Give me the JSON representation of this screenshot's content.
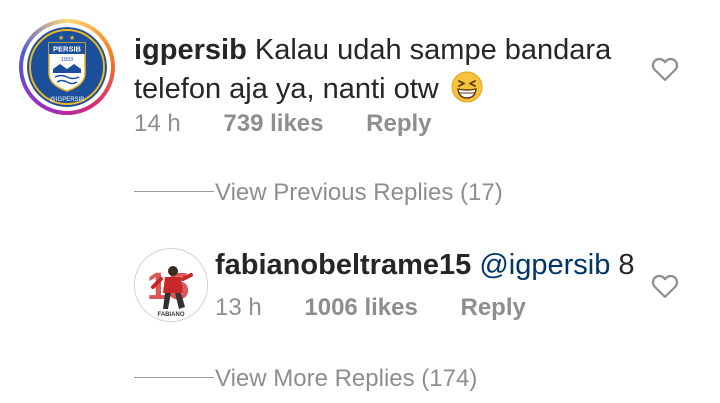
{
  "comment": {
    "username": "igpersib",
    "text_line1": "Kalau udah sampe bandara",
    "text_line2": "telefon aja ya, nanti otw",
    "emoji": "grinning-squinting-face",
    "time": "14 h",
    "likes": "739 likes",
    "reply_label": "Reply",
    "avatar_logo_text": "PERSIB",
    "avatar_logo_year": "1933",
    "avatar_caption": "@IGPERSIB"
  },
  "view_previous": "View Previous Replies (17)",
  "reply": {
    "username": "fabianobeltrame15",
    "mention": "@igpersib",
    "text": "8",
    "time": "13 h",
    "likes": "1006 likes",
    "reply_label": "Reply",
    "avatar_caption": "FABIANO"
  },
  "view_more": "View More Replies (174)",
  "colors": {
    "text": "#262626",
    "muted": "#8e8e8e",
    "mention": "#003569",
    "persib_blue": "#1b4f9c",
    "persib_gold": "#e9b824"
  }
}
